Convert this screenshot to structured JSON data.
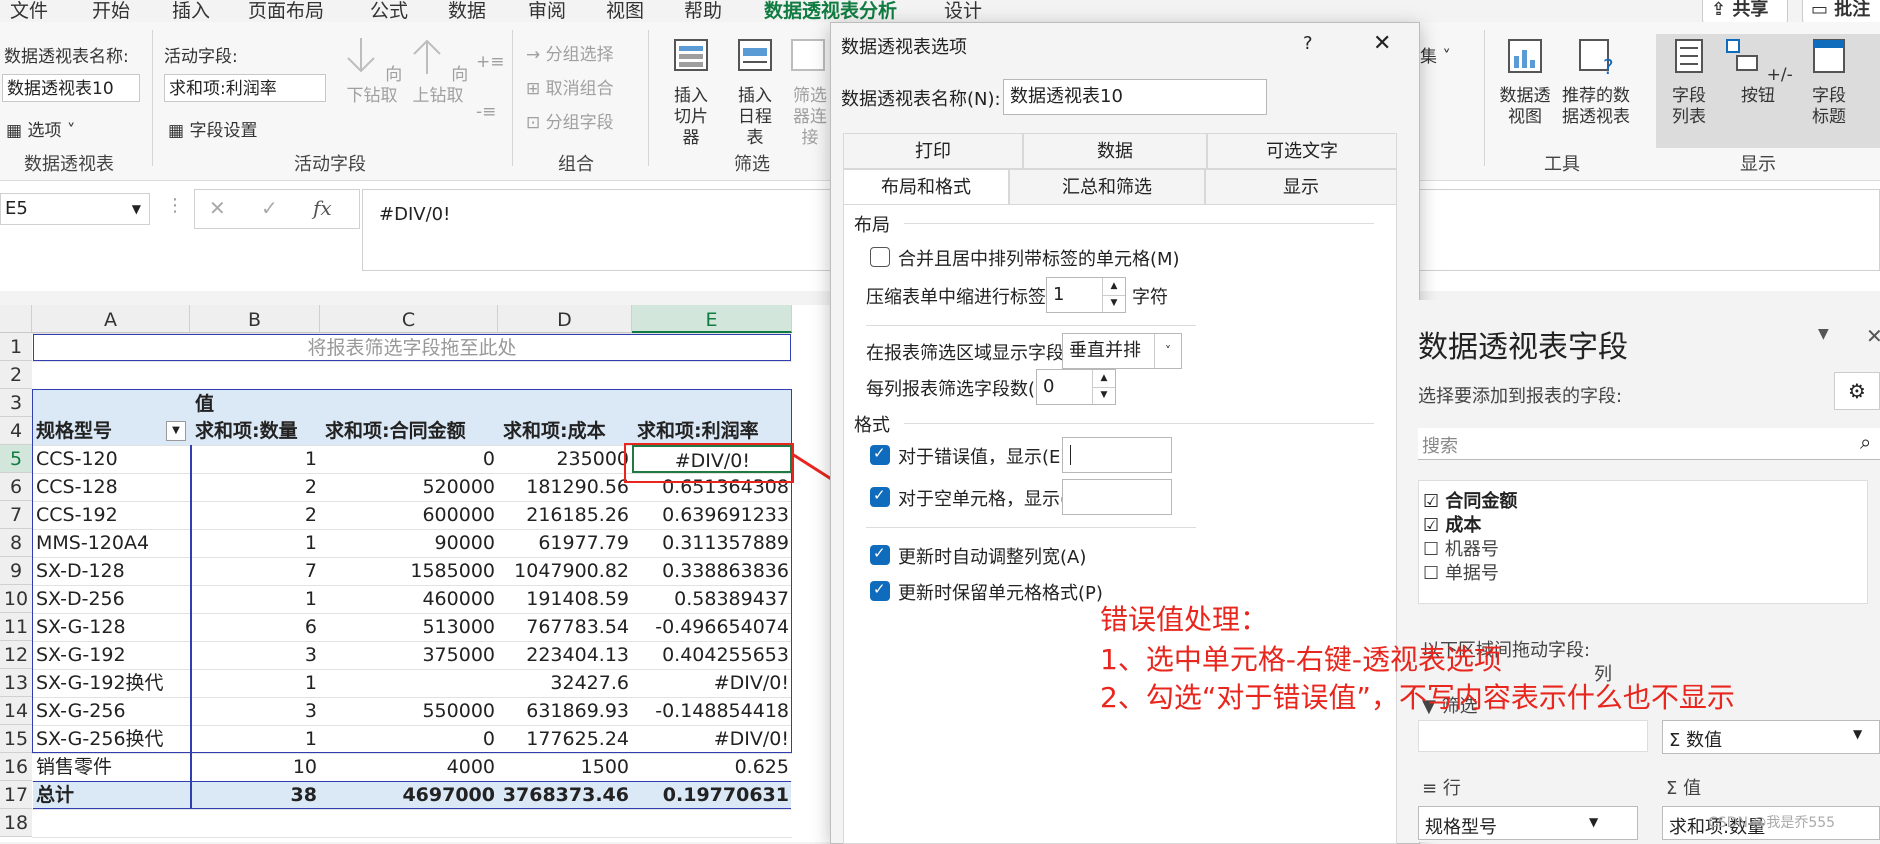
{
  "ribbon_tabs": [
    "文件",
    "开始",
    "插入",
    "页面布局",
    "公式",
    "数据",
    "审阅",
    "视图",
    "帮助",
    "数据透视表分析",
    "设计"
  ],
  "top_buttons": {
    "share": "共享",
    "comment": "批注"
  },
  "ribbon": {
    "pivot_name_label": "数据透视表名称:",
    "pivot_name_value": "数据透视表10",
    "options_label": "选项",
    "group_pivot": "数据透视表",
    "active_field_label": "活动字段:",
    "active_field_value": "求和项:利润率",
    "field_settings": "字段设置",
    "drill_down": "向下钻取",
    "drill_up": "向上钻取",
    "group_active_field": "活动字段",
    "group_selection": "分组选择",
    "ungroup": "取消组合",
    "group_field": "分组字段",
    "group_group": "组合",
    "insert_slicer": "插入切片器",
    "insert_timeline": "插入日程表",
    "filter_connections": "筛选器连接",
    "group_filter": "筛选",
    "collection_partial": "集",
    "pivot_chart": "数据透视图",
    "recommended_pivot": "推荐的数据透视表",
    "group_tools": "工具",
    "field_list": "字段列表",
    "plus_minus_buttons": "+/- 按钮",
    "field_headers": "字段标题",
    "group_show": "显示"
  },
  "formula_bar": {
    "name_box": "E5",
    "fx": "fx",
    "content": "#DIV/0!"
  },
  "sheet": {
    "columns": [
      "A",
      "B",
      "C",
      "D",
      "E"
    ],
    "rows": [
      "1",
      "2",
      "3",
      "4",
      "5",
      "6",
      "7",
      "8",
      "9",
      "10",
      "11",
      "12",
      "13",
      "14",
      "15",
      "16",
      "17",
      "18"
    ],
    "filter_drop_hint": "将报表筛选字段拖至此处",
    "values_label": "值",
    "headers": [
      "规格型号",
      "求和项:数量",
      "求和项:合同金额",
      "求和项:成本",
      "求和项:利润率"
    ],
    "data": [
      [
        "CCS-120",
        "1",
        "0",
        "235000",
        "#DIV/0!"
      ],
      [
        "CCS-128",
        "2",
        "520000",
        "181290.56",
        "0.651364308"
      ],
      [
        "CCS-192",
        "2",
        "600000",
        "216185.26",
        "0.639691233"
      ],
      [
        "MMS-120A4",
        "1",
        "90000",
        "61977.79",
        "0.311357889"
      ],
      [
        "SX-D-128",
        "7",
        "1585000",
        "1047900.82",
        "0.338863836"
      ],
      [
        "SX-D-256",
        "1",
        "460000",
        "191408.59",
        "0.58389437"
      ],
      [
        "SX-G-128",
        "6",
        "513000",
        "767783.54",
        "-0.496654074"
      ],
      [
        "SX-G-192",
        "3",
        "375000",
        "223404.13",
        "0.404255653"
      ],
      [
        "SX-G-192换代",
        "1",
        "",
        "32427.6",
        "#DIV/0!"
      ],
      [
        "SX-G-256",
        "3",
        "550000",
        "631869.93",
        "-0.148854418"
      ],
      [
        "SX-G-256换代",
        "1",
        "0",
        "177625.24",
        "#DIV/0!"
      ],
      [
        "销售零件",
        "10",
        "4000",
        "1500",
        "0.625"
      ]
    ],
    "total": [
      "总计",
      "38",
      "4697000",
      "3768373.46",
      "0.19770631"
    ]
  },
  "dialog": {
    "title": "数据透视表选项",
    "help": "?",
    "close": "✕",
    "name_label": "数据透视表名称(N):",
    "name_value": "数据透视表10",
    "tabs_row1": [
      "打印",
      "数据",
      "可选文字"
    ],
    "tabs_row2": [
      "布局和格式",
      "汇总和筛选",
      "显示"
    ],
    "section_layout": "布局",
    "merge_center": "合并且居中排列带标签的单元格(M)",
    "indent_label": "压缩表单中缩进行标签(C):",
    "indent_value": "1",
    "indent_unit": "字符",
    "filter_area_label": "在报表筛选区域显示字段(D):",
    "filter_area_value": "垂直并排",
    "fields_per_col_label": "每列报表筛选字段数(F):",
    "fields_per_col_value": "0",
    "section_format": "格式",
    "error_value_label": "对于错误值，显示(E):",
    "error_value": "",
    "empty_cell_label": "对于空单元格，显示(S):",
    "empty_cell_value": "",
    "autofit_label": "更新时自动调整列宽(A)",
    "preserve_format_label": "更新时保留单元格格式(P)"
  },
  "annotation": {
    "line1": "错误值处理：",
    "line2": "1、选中单元格-右键-透视表选项",
    "line3": "2、勾选“对于错误值”，不写内容表示什么也不显示"
  },
  "field_pane": {
    "title": "数据透视表字段",
    "subtitle": "选择要添加到报表的字段:",
    "search_placeholder": "搜索",
    "fields": [
      "合同金额",
      "成本",
      "机器号",
      "单据号"
    ],
    "drag_label": "以下区域间拖动字段:",
    "filter_label": "筛选",
    "columns_label": "列",
    "values_chip": "Σ 数值",
    "rows_label": "行",
    "values_label": "值",
    "row_chip": "规格型号",
    "value_chip": "求和项:数量",
    "watermark": "CSDN @我是乔555"
  }
}
